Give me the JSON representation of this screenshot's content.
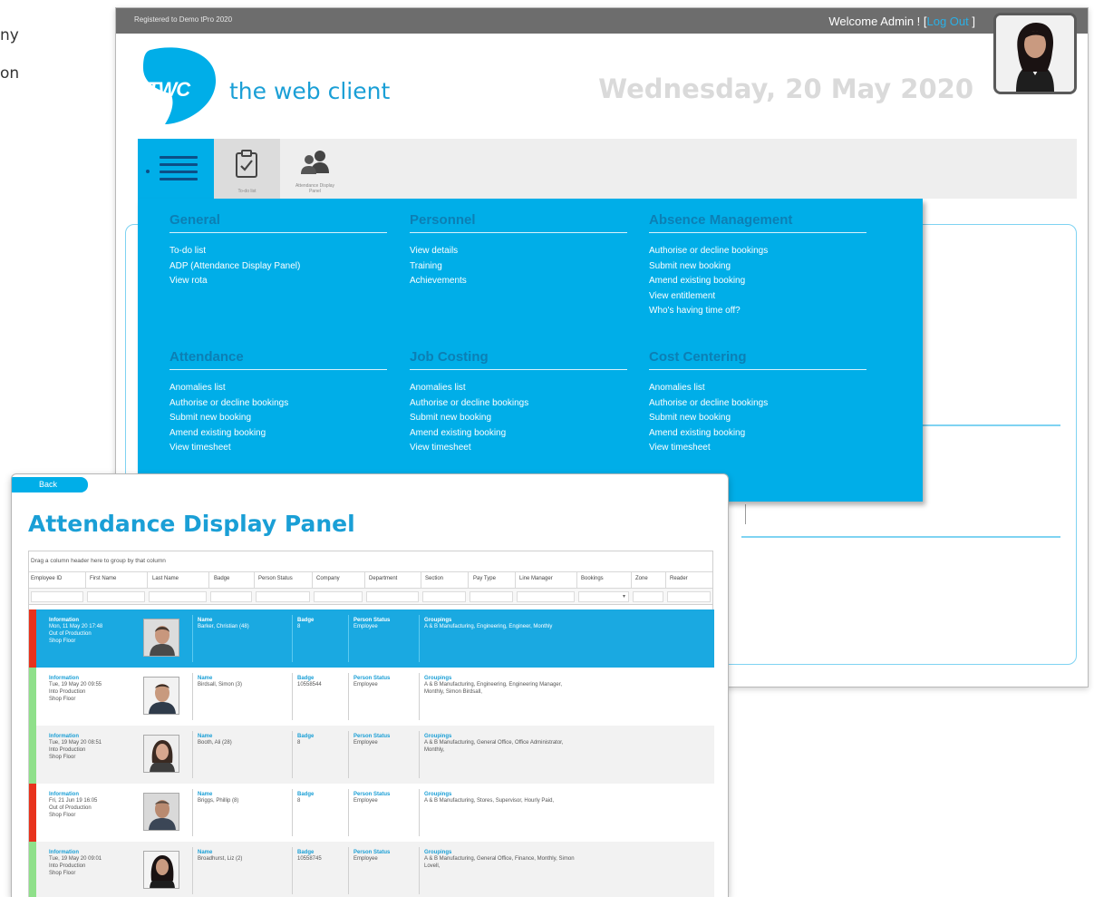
{
  "side_text": [
    "ny",
    "on"
  ],
  "header": {
    "registered": "Registered to Demo tPro 2020",
    "welcome": "Welcome Admin ! [",
    "logout": "Log Out",
    "close_bracket": " ]",
    "logo_text": "TWC",
    "brand_name": "the web client",
    "date": "Wednesday, 20 May 2020"
  },
  "nav": {
    "todo_label": "To-do list",
    "adp_label": "Attendance Display Panel"
  },
  "menu": {
    "columns": [
      {
        "heading": "General",
        "items": [
          "To-do list",
          "ADP (Attendance Display Panel)",
          "View rota"
        ]
      },
      {
        "heading": "Personnel",
        "items": [
          "View details",
          "Training",
          "Achievements"
        ]
      },
      {
        "heading": "Absence Management",
        "items": [
          "Authorise or decline bookings",
          "Submit new booking",
          "Amend existing booking",
          "View entitlement",
          "Who's having time off?"
        ]
      },
      {
        "heading": "Attendance",
        "items": [
          "Anomalies list",
          "Authorise or decline bookings",
          "Submit new booking",
          "Amend existing booking",
          "View timesheet"
        ]
      },
      {
        "heading": "Job Costing",
        "items": [
          "Anomalies list",
          "Authorise or decline bookings",
          "Submit new booking",
          "Amend existing booking",
          "View timesheet"
        ]
      },
      {
        "heading": "Cost Centering",
        "items": [
          "Anomalies list",
          "Authorise or decline bookings",
          "Submit new booking",
          "Amend existing booking",
          "View timesheet"
        ]
      }
    ]
  },
  "adp": {
    "back": "Back",
    "title": "Attendance Display Panel",
    "group_hint": "Drag a column header here to group by that column",
    "columns": [
      "Employee ID",
      "First Name",
      "Last Name",
      "Badge",
      "Person Status",
      "Company",
      "Department",
      "Section",
      "Pay Type",
      "Line Manager",
      "Bookings",
      "Zone",
      "Reader"
    ],
    "labels": {
      "info": "Information",
      "name": "Name",
      "badge": "Badge",
      "status": "Person Status",
      "groupings": "Groupings"
    },
    "records": [
      {
        "info": [
          "Mon, 11 May 20 17:48",
          "Out of Production",
          "Shop Floor"
        ],
        "name": "Barker, Christian (48)",
        "badge": "8",
        "status": "Employee",
        "groupings": [
          "A & B Manufacturing, Engineering, Engineer, Monthly"
        ],
        "state": "out",
        "selected": true
      },
      {
        "info": [
          "Tue, 19 May 20 09:55",
          "Into Production",
          "Shop Floor"
        ],
        "name": "Birdsall, Simon (3)",
        "badge": "10558544",
        "status": "Employee",
        "groupings": [
          "A & B Manufacturing, Engineering, Engineering Manager,",
          "Monthly, Simon Birdsall,"
        ],
        "state": "in",
        "selected": false
      },
      {
        "info": [
          "Tue, 19 May 20 08:51",
          "Into Production",
          "Shop Floor"
        ],
        "name": "Booth, Ali (28)",
        "badge": "8",
        "status": "Employee",
        "groupings": [
          "A & B Manufacturing, General Office, Office Administrator,",
          "Monthly,"
        ],
        "state": "in",
        "selected": false
      },
      {
        "info": [
          "Fri, 21 Jun 19 16:05",
          "Out of Production",
          "Shop Floor"
        ],
        "name": "Briggs, Phillip (8)",
        "badge": "8",
        "status": "Employee",
        "groupings": [
          "A & B Manufacturing, Stores, Supervisor, Hourly Paid,"
        ],
        "state": "out",
        "selected": false
      },
      {
        "info": [
          "Tue, 19 May 20 09:01",
          "Into Production",
          "Shop Floor"
        ],
        "name": "Broadhurst, Liz (2)",
        "badge": "10558745",
        "status": "Employee",
        "groupings": [
          "A & B Manufacturing, General Office, Finance, Monthly, Simon",
          "Lovell,"
        ],
        "state": "in",
        "selected": false
      }
    ]
  },
  "colors": {
    "accent": "#00aee8",
    "brand": "#1a9fd6",
    "in": "#8fe08a",
    "out": "#e8321c",
    "heading": "#0c7fb4"
  }
}
